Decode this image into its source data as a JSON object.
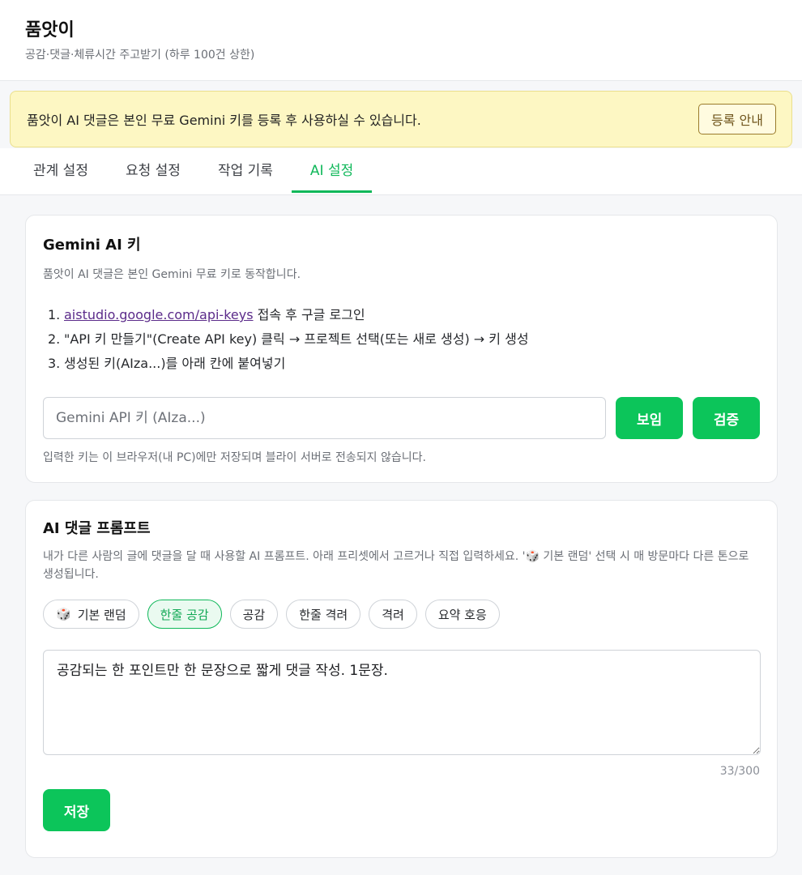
{
  "app": {
    "title": "품앗이",
    "subtitle": "공감·댓글·체류시간 주고받기 (하루 100건 상한)"
  },
  "notice": {
    "text": "품앗이 AI 댓글은 본인 무료 Gemini 키를 등록 후 사용하실 수 있습니다.",
    "button_label": "등록 안내"
  },
  "tabs": [
    {
      "label": "관계 설정",
      "active": false
    },
    {
      "label": "요청 설정",
      "active": false
    },
    {
      "label": "작업 기록",
      "active": false
    },
    {
      "label": "AI 설정",
      "active": true
    }
  ],
  "gemini_card": {
    "title": "Gemini AI 키",
    "description": "품앗이 AI 댓글은 본인 Gemini 무료 키로 동작합니다.",
    "steps": [
      {
        "num": "1.",
        "link": "aistudio.google.com/api-keys",
        "text": " 접속 후 구글 로그인"
      },
      {
        "num": "2.",
        "text": "\"API 키 만들기\"(Create API key) 클릭 → 프로젝트 선택(또는 새로 생성) → 키 생성"
      },
      {
        "num": "3.",
        "text": "생성된 키(AIza...)를 아래 칸에 붙여넣기"
      }
    ],
    "input_placeholder": "Gemini API 키 (AIza...)",
    "input_value": "",
    "show_label": "보임",
    "verify_label": "검증",
    "note": "입력한 키는 이 브라우저(내 PC)에만 저장되며 블라이 서버로 전송되지 않습니다."
  },
  "prompt_card": {
    "title": "AI 댓글 프롬프트",
    "description": "내가 다른 사람의 글에 댓글을 달 때 사용할 AI 프롬프트. 아래 프리셋에서 고르거나 직접 입력하세요. '🎲 기본 랜덤' 선택 시 매 방문마다 다른 톤으로 생성됩니다.",
    "presets": [
      {
        "label": "기본 랜덤",
        "icon": "🎲",
        "active": false
      },
      {
        "label": "한줄 공감",
        "active": true
      },
      {
        "label": "공감",
        "active": false
      },
      {
        "label": "한줄 격려",
        "active": false
      },
      {
        "label": "격려",
        "active": false
      },
      {
        "label": "요약 호응",
        "active": false
      }
    ],
    "prompt_value": "공감되는 한 포인트만 한 문장으로 짧게 댓글 작성. 1문장.",
    "counter": "33/300",
    "save_label": "저장"
  },
  "colors": {
    "accent": "#10b85a",
    "button_green": "#0cc55a",
    "notice_bg": "#fdf7c3"
  }
}
